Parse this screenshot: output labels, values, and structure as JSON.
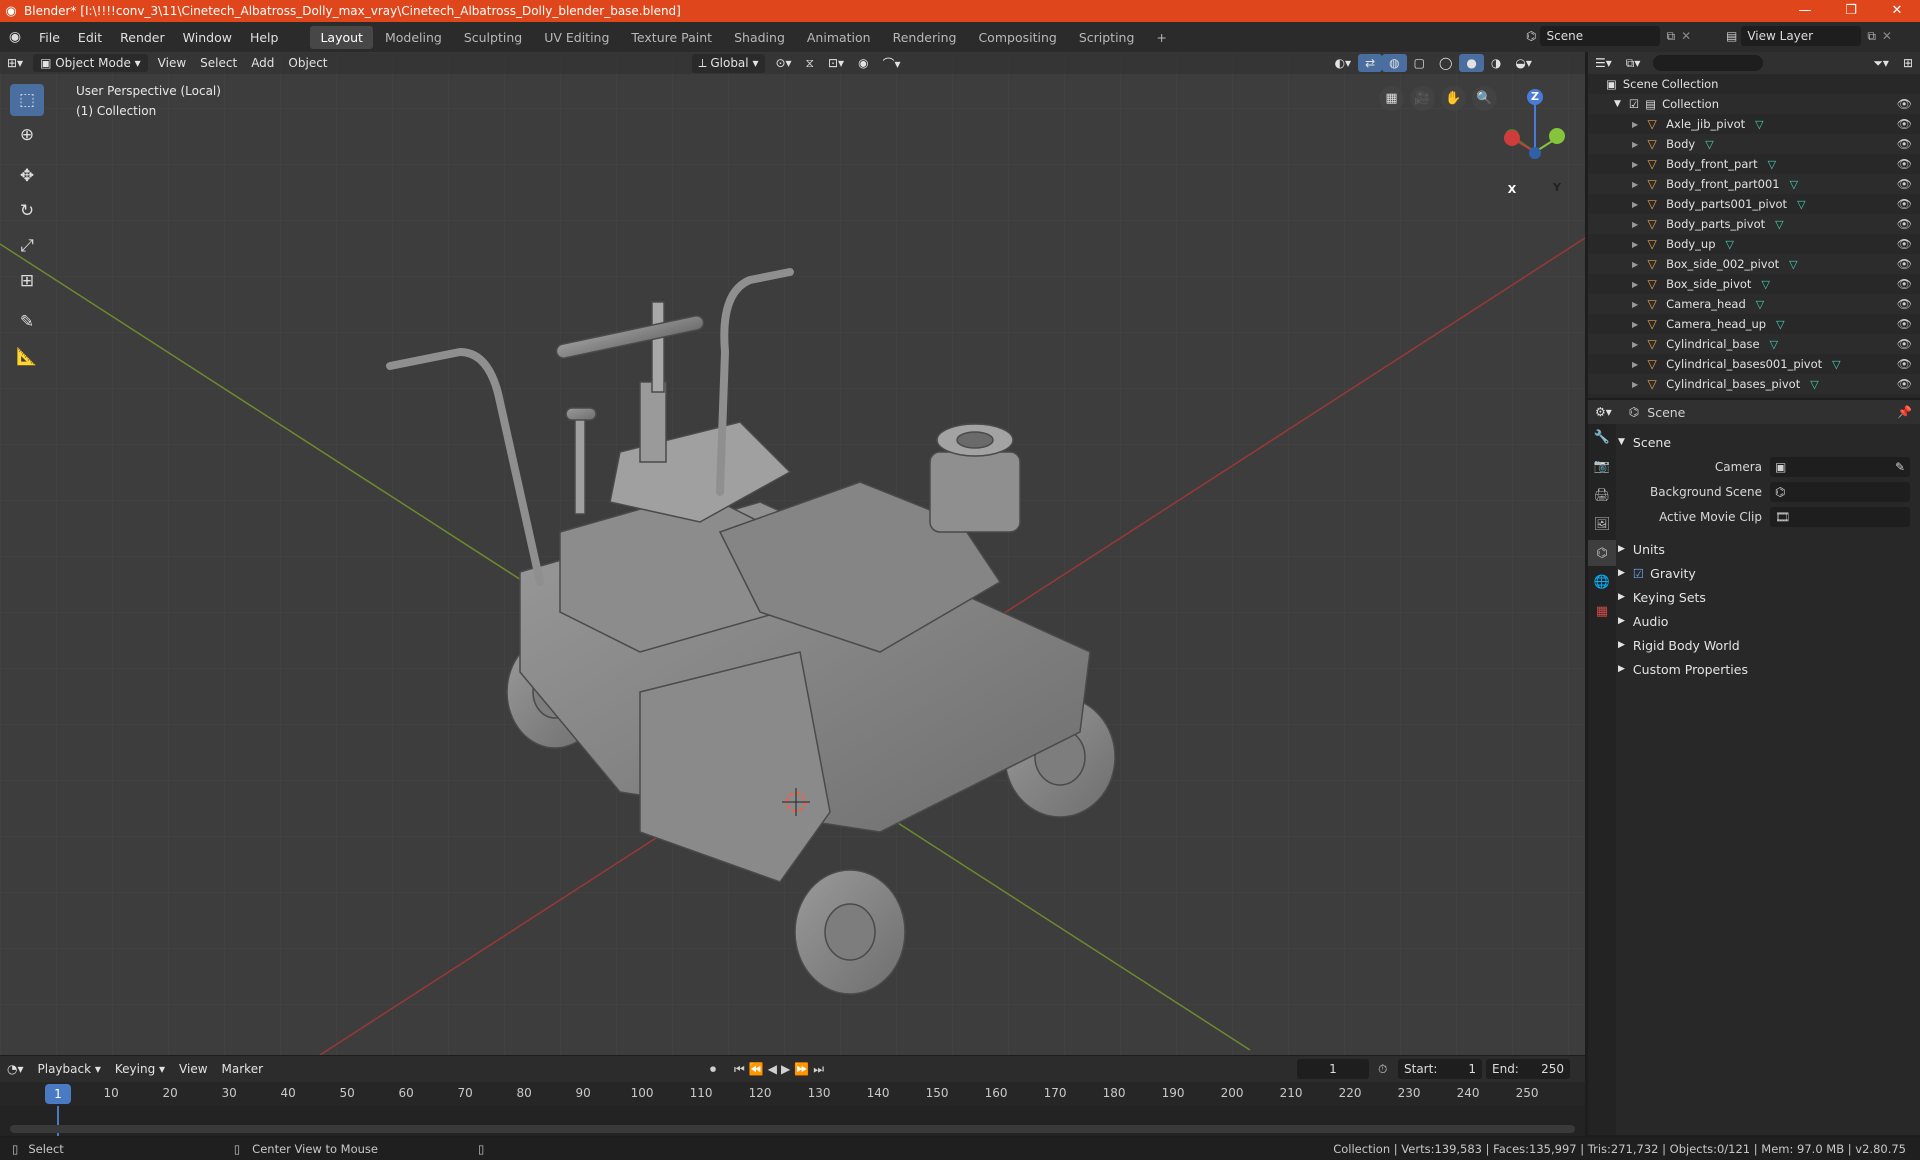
{
  "window": {
    "title": "Blender* [I:\\!!!!conv_3\\11\\Cinetech_Albatross_Dolly_max_vray\\Cinetech_Albatross_Dolly_blender_base.blend]",
    "minimize": "—",
    "maximize": "❐",
    "close": "✕"
  },
  "menu": [
    "File",
    "Edit",
    "Render",
    "Window",
    "Help"
  ],
  "workspaces": [
    {
      "label": "Layout",
      "active": true
    },
    {
      "label": "Modeling"
    },
    {
      "label": "Sculpting"
    },
    {
      "label": "UV Editing"
    },
    {
      "label": "Texture Paint"
    },
    {
      "label": "Shading"
    },
    {
      "label": "Animation"
    },
    {
      "label": "Rendering"
    },
    {
      "label": "Compositing"
    },
    {
      "label": "Scripting"
    }
  ],
  "add_workspace": "+",
  "scene_selector": "Scene",
  "view_layer": "View Layer",
  "viewport": {
    "mode": "Object Mode",
    "menus": [
      "View",
      "Select",
      "Add",
      "Object"
    ],
    "orientation": "Global",
    "perspective_label": "User Perspective (Local)",
    "collection_label": "(1) Collection",
    "gizmo": {
      "x": "X",
      "y": "Y",
      "z": "Z"
    }
  },
  "outliner": {
    "search_placeholder": "",
    "root": "Scene Collection",
    "collection": "Collection",
    "items": [
      "Axle_jib_pivot",
      "Body",
      "Body_front_part",
      "Body_front_part001",
      "Body_parts001_pivot",
      "Body_parts_pivot",
      "Body_up",
      "Box_side_002_pivot",
      "Box_side_pivot",
      "Camera_head",
      "Camera_head_up",
      "Cylindrical_base",
      "Cylindrical_bases001_pivot",
      "Cylindrical_bases_pivot"
    ]
  },
  "properties": {
    "header": "Scene",
    "section": "Scene",
    "rows": [
      {
        "label": "Camera",
        "value": ""
      },
      {
        "label": "Background Scene",
        "value": ""
      },
      {
        "label": "Active Movie Clip",
        "value": ""
      }
    ],
    "subsections": [
      "Units",
      "Gravity",
      "Keying Sets",
      "Audio",
      "Rigid Body World",
      "Custom Properties"
    ]
  },
  "timeline": {
    "menus": [
      "Playback",
      "Keying",
      "View",
      "Marker"
    ],
    "current_frame": "1",
    "start_label": "Start:",
    "start": "1",
    "end_label": "End:",
    "end": "250",
    "ticks": [
      "10",
      "20",
      "30",
      "40",
      "50",
      "60",
      "70",
      "80",
      "90",
      "100",
      "110",
      "120",
      "130",
      "140",
      "150",
      "160",
      "170",
      "180",
      "190",
      "200",
      "210",
      "220",
      "230",
      "240",
      "250"
    ],
    "current_marker": "1"
  },
  "status": {
    "left_action": "Select",
    "mid_action": "Center View to Mouse",
    "stats": "Collection | Verts:139,583 | Faces:135,997 | Tris:271,732 | Objects:0/121 | Mem: 97.0 MB | v2.80.75"
  }
}
